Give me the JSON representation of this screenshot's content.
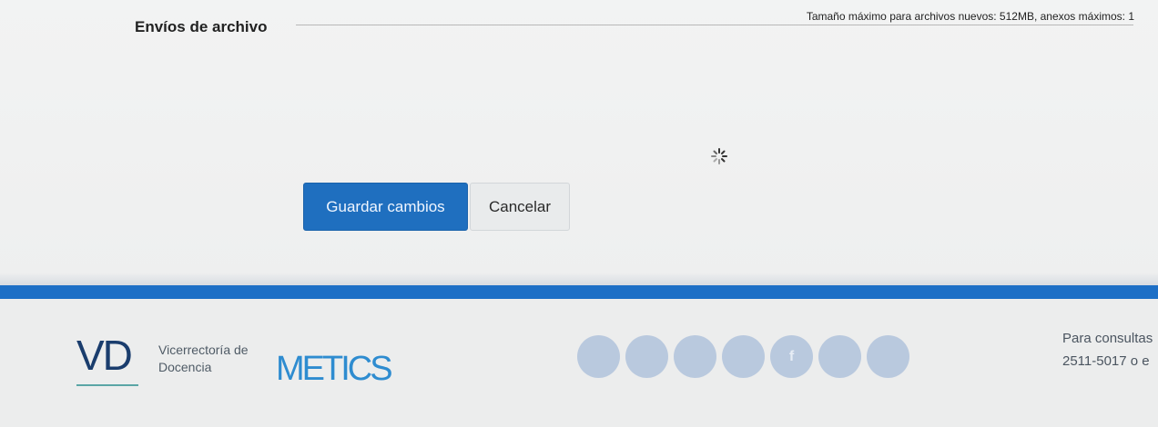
{
  "form": {
    "section_title": "Envíos de archivo",
    "file_limits": "Tamaño máximo para archivos nuevos: 512MB, anexos máximos: 1",
    "loading_icon": "spinner-icon"
  },
  "buttons": {
    "save_label": "Guardar cambios",
    "cancel_label": "Cancelar"
  },
  "footer": {
    "logo_vd": "VD",
    "institution_line1": "Vicerrectoría de",
    "institution_line2": "Docencia",
    "brand": "METICS",
    "social_icons": [
      "circle-icon",
      "circle-icon",
      "circle-icon",
      "circle-icon",
      "facebook-icon",
      "circle-icon",
      "circle-icon"
    ],
    "contact_line1": "Para consultas",
    "contact_line2": "2511-5017 o e"
  },
  "colors": {
    "primary": "#1f6fbf",
    "footer_bar": "#1d6fc6"
  }
}
